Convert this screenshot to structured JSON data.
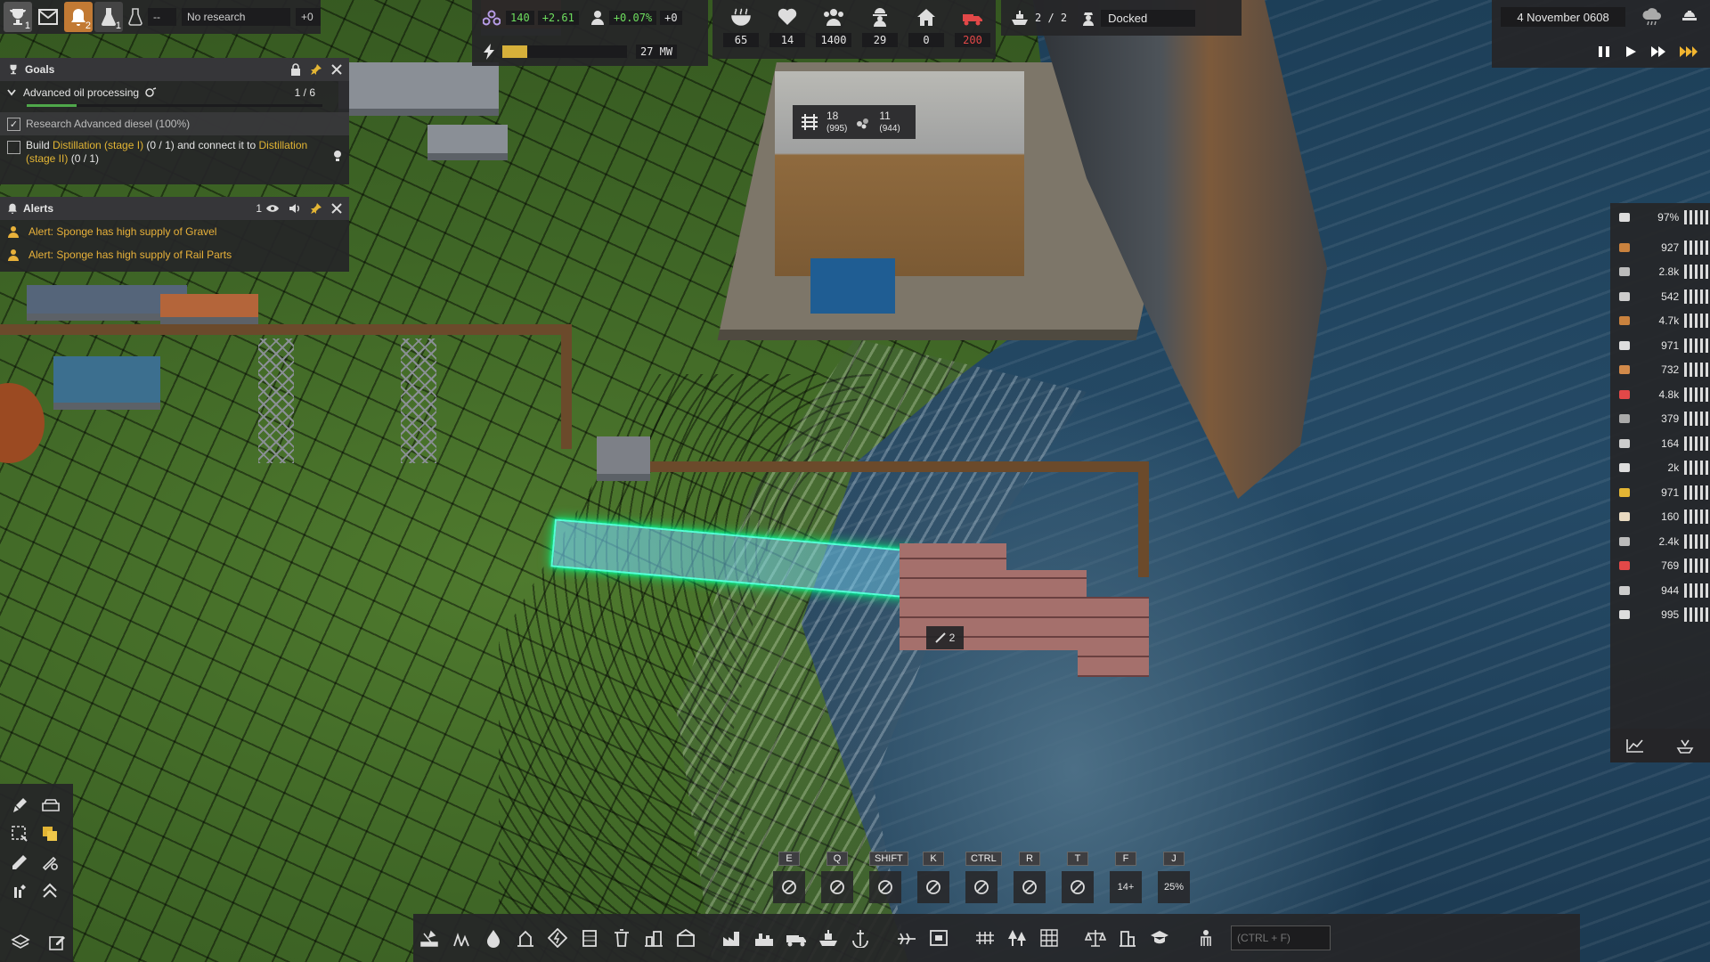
{
  "top_left": {
    "goals_badge": "1",
    "alerts_badge": "2",
    "research_badge": "1",
    "research_value": "--",
    "research_status": "No research",
    "research_delta": "+0"
  },
  "stats": {
    "unity_value": "140",
    "unity_delta": "+2.61",
    "pop_growth": "+0.07%",
    "pop_delta": "+0",
    "power_value": "27 MW",
    "power_fill": 0.2
  },
  "population": {
    "food": "65",
    "health": "14",
    "population": "1400",
    "workers": "29",
    "homes": "0",
    "vehicles": "200"
  },
  "ship": {
    "crew": "2 / 2",
    "status": "Docked"
  },
  "date": {
    "text": "4 November 0608"
  },
  "goals": {
    "title": "Goals",
    "goal_name": "Advanced oil processing",
    "goal_progress": "1 / 6",
    "task1": "Research Advanced diesel (100%)",
    "task2_prefix": "Build ",
    "task2_link1": "Distillation (stage I)",
    "task2_mid": " (0 / 1) and connect it to ",
    "task2_link2": "Distillation (stage II)",
    "task2_suffix": " (0 / 1)"
  },
  "alerts": {
    "title": "Alerts",
    "count": "1",
    "items": [
      "Alert: Sponge has high supply of Gravel",
      "Alert: Sponge has high supply of Rail Parts"
    ]
  },
  "world_labels": {
    "rail_a": "18",
    "rail_a_sub": "(995)",
    "rail_b": "11",
    "rail_b_sub": "(944)",
    "build_count": "2"
  },
  "resources": [
    {
      "icon": "tools-icon",
      "value": "97%"
    },
    {
      "icon": "wood-icon",
      "value": "927"
    },
    {
      "icon": "rock-icon",
      "value": "2.8k"
    },
    {
      "icon": "sheet-icon",
      "value": "542"
    },
    {
      "icon": "logs-icon",
      "value": "4.7k"
    },
    {
      "icon": "worker-icon",
      "value": "971"
    },
    {
      "icon": "planks-icon",
      "value": "732"
    },
    {
      "icon": "fuel-icon",
      "value": "4.8k"
    },
    {
      "icon": "iron-icon",
      "value": "379"
    },
    {
      "icon": "shovel-icon",
      "value": "164"
    },
    {
      "icon": "block-icon",
      "value": "2k"
    },
    {
      "icon": "hardhat-icon",
      "value": "971"
    },
    {
      "icon": "food-icon",
      "value": "160"
    },
    {
      "icon": "plate-icon",
      "value": "2.4k"
    },
    {
      "icon": "worker-red-icon",
      "value": "769"
    },
    {
      "icon": "gravel-icon",
      "value": "944"
    },
    {
      "icon": "rail-icon",
      "value": "995"
    }
  ],
  "hotkeys": [
    "E",
    "Q",
    "SHIFT",
    "K",
    "CTRL",
    "R",
    "T",
    "F",
    "J"
  ],
  "hotkey_values": {
    "height": "14+",
    "slope": "25%"
  },
  "search_placeholder": "(CTRL + F)",
  "colors": {
    "accent": "#c27a34",
    "alert": "#e8b13a",
    "positive": "#6ede5e",
    "build_highlight": "#00ff7a"
  }
}
